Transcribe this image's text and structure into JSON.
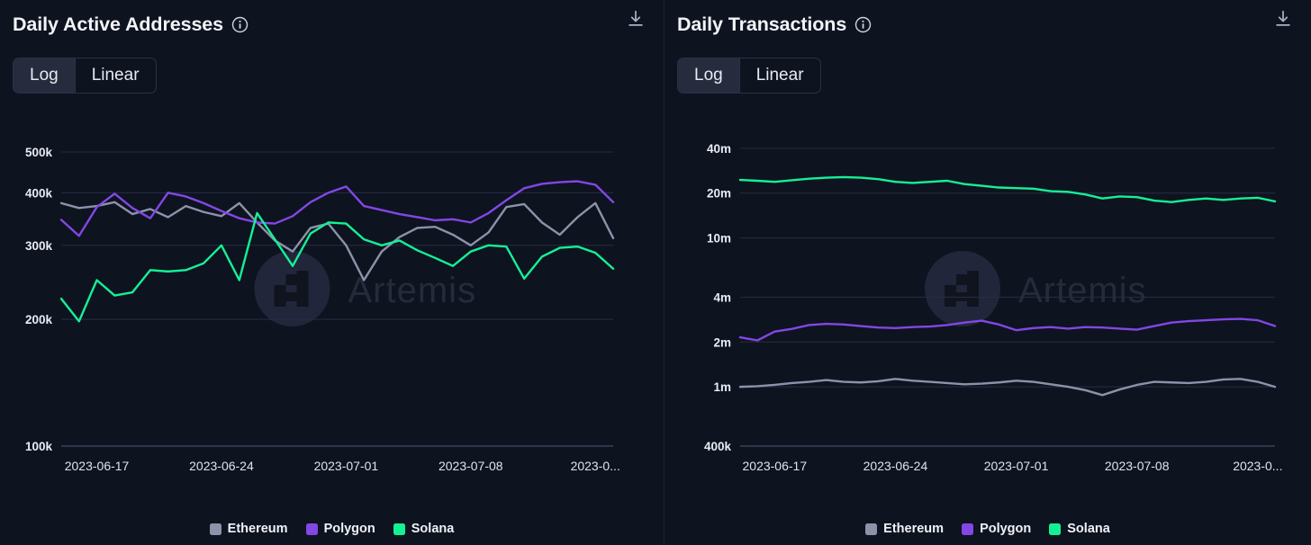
{
  "theme": {
    "background": "#0e1320",
    "grid_color": "#272d44",
    "text_color": "#e9ecf3",
    "divider": "#1c2233"
  },
  "series_colors": {
    "Ethereum": "#8c93a8",
    "Polygon": "#8247e5",
    "Solana": "#14f195"
  },
  "watermark": {
    "label": "Artemis"
  },
  "panels": [
    {
      "key": "daily_active_addresses",
      "title": "Daily Active Addresses",
      "info_icon": "info-circle-icon",
      "download_icon": "download-icon",
      "scale_toggle": {
        "options": [
          "Log",
          "Linear"
        ],
        "selected": "Log"
      },
      "legend": [
        {
          "label": "Ethereum",
          "color": "#8c93a8"
        },
        {
          "label": "Polygon",
          "color": "#8247e5"
        },
        {
          "label": "Solana",
          "color": "#14f195"
        }
      ]
    },
    {
      "key": "daily_transactions",
      "title": "Daily Transactions",
      "info_icon": "info-circle-icon",
      "download_icon": "download-icon",
      "scale_toggle": {
        "options": [
          "Log",
          "Linear"
        ],
        "selected": "Log"
      },
      "legend": [
        {
          "label": "Ethereum",
          "color": "#8c93a8"
        },
        {
          "label": "Polygon",
          "color": "#8247e5"
        },
        {
          "label": "Solana",
          "color": "#14f195"
        }
      ]
    }
  ],
  "chart_data": [
    {
      "type": "line",
      "title": "Daily Active Addresses",
      "xlabel": "",
      "ylabel": "",
      "yscale": "log",
      "grid": true,
      "legend_position": "bottom",
      "ytick_labels": [
        "500k",
        "400k",
        "300k",
        "200k",
        "100k"
      ],
      "ytick_values": [
        500000,
        400000,
        300000,
        200000,
        100000
      ],
      "ylim": [
        100000,
        560000
      ],
      "xtick_labels": [
        "2023-06-17",
        "2023-06-24",
        "2023-07-01",
        "2023-07-08",
        "2023-0..."
      ],
      "x": [
        "2023-06-15",
        "2023-06-16",
        "2023-06-17",
        "2023-06-18",
        "2023-06-19",
        "2023-06-20",
        "2023-06-21",
        "2023-06-22",
        "2023-06-23",
        "2023-06-24",
        "2023-06-25",
        "2023-06-26",
        "2023-06-27",
        "2023-06-28",
        "2023-06-29",
        "2023-06-30",
        "2023-07-01",
        "2023-07-02",
        "2023-07-03",
        "2023-07-04",
        "2023-07-05",
        "2023-07-06",
        "2023-07-07",
        "2023-07-08",
        "2023-07-09",
        "2023-07-10",
        "2023-07-11",
        "2023-07-12",
        "2023-07-13",
        "2023-07-14",
        "2023-07-15",
        "2023-07-16"
      ],
      "series": [
        {
          "name": "Ethereum",
          "color": "#8c93a8",
          "values": [
            378000,
            368000,
            372000,
            380000,
            356000,
            366000,
            350000,
            372000,
            360000,
            352000,
            378000,
            340000,
            308000,
            290000,
            330000,
            338000,
            300000,
            248000,
            290000,
            314000,
            330000,
            332000,
            318000,
            300000,
            322000,
            370000,
            376000,
            340000,
            318000,
            350000,
            378000,
            312000
          ]
        },
        {
          "name": "Polygon",
          "color": "#8247e5",
          "values": [
            345000,
            316000,
            370000,
            398000,
            368000,
            348000,
            400000,
            392000,
            378000,
            362000,
            348000,
            340000,
            338000,
            352000,
            380000,
            400000,
            414000,
            372000,
            364000,
            356000,
            350000,
            344000,
            346000,
            340000,
            358000,
            384000,
            410000,
            420000,
            424000,
            426000,
            418000,
            380000
          ]
        },
        {
          "name": "Solana",
          "color": "#14f195",
          "values": [
            224000,
            198000,
            248000,
            228000,
            232000,
            262000,
            260000,
            262000,
            272000,
            300000,
            248000,
            358000,
            310000,
            268000,
            320000,
            340000,
            338000,
            310000,
            300000,
            308000,
            292000,
            280000,
            268000,
            290000,
            300000,
            298000,
            250000,
            282000,
            296000,
            298000,
            288000,
            264000
          ]
        }
      ]
    },
    {
      "type": "line",
      "title": "Daily Transactions",
      "xlabel": "",
      "ylabel": "",
      "yscale": "log",
      "grid": true,
      "legend_position": "bottom",
      "ytick_labels": [
        "40m",
        "20m",
        "10m",
        "4m",
        "2m",
        "1m",
        "400k"
      ],
      "ytick_values": [
        40000000,
        20000000,
        10000000,
        4000000,
        2000000,
        1000000,
        400000
      ],
      "ylim": [
        400000,
        52000000
      ],
      "xtick_labels": [
        "2023-06-17",
        "2023-06-24",
        "2023-07-01",
        "2023-07-08",
        "2023-0..."
      ],
      "x": [
        "2023-06-15",
        "2023-06-16",
        "2023-06-17",
        "2023-06-18",
        "2023-06-19",
        "2023-06-20",
        "2023-06-21",
        "2023-06-22",
        "2023-06-23",
        "2023-06-24",
        "2023-06-25",
        "2023-06-26",
        "2023-06-27",
        "2023-06-28",
        "2023-06-29",
        "2023-06-30",
        "2023-07-01",
        "2023-07-02",
        "2023-07-03",
        "2023-07-04",
        "2023-07-05",
        "2023-07-06",
        "2023-07-07",
        "2023-07-08",
        "2023-07-09",
        "2023-07-10",
        "2023-07-11",
        "2023-07-12",
        "2023-07-13",
        "2023-07-14",
        "2023-07-15",
        "2023-07-16"
      ],
      "series": [
        {
          "name": "Ethereum",
          "color": "#8c93a8",
          "values": [
            1000000,
            1010000,
            1030000,
            1060000,
            1080000,
            1110000,
            1080000,
            1070000,
            1090000,
            1130000,
            1100000,
            1080000,
            1060000,
            1040000,
            1050000,
            1070000,
            1100000,
            1080000,
            1040000,
            1000000,
            950000,
            880000,
            960000,
            1030000,
            1080000,
            1070000,
            1060000,
            1080000,
            1120000,
            1130000,
            1080000,
            1000000
          ]
        },
        {
          "name": "Polygon",
          "color": "#8247e5",
          "values": [
            2150000,
            2050000,
            2350000,
            2450000,
            2600000,
            2650000,
            2620000,
            2560000,
            2500000,
            2480000,
            2520000,
            2540000,
            2600000,
            2700000,
            2780000,
            2620000,
            2400000,
            2480000,
            2520000,
            2460000,
            2520000,
            2500000,
            2460000,
            2420000,
            2560000,
            2700000,
            2760000,
            2800000,
            2840000,
            2860000,
            2800000,
            2560000
          ]
        },
        {
          "name": "Solana",
          "color": "#14f195",
          "values": [
            24500000,
            24200000,
            23800000,
            24400000,
            25000000,
            25400000,
            25600000,
            25400000,
            24800000,
            23800000,
            23400000,
            23800000,
            24200000,
            23000000,
            22400000,
            21800000,
            21600000,
            21400000,
            20600000,
            20400000,
            19600000,
            18400000,
            19000000,
            18800000,
            17800000,
            17400000,
            18000000,
            18400000,
            18000000,
            18400000,
            18600000,
            17600000
          ]
        }
      ]
    }
  ]
}
